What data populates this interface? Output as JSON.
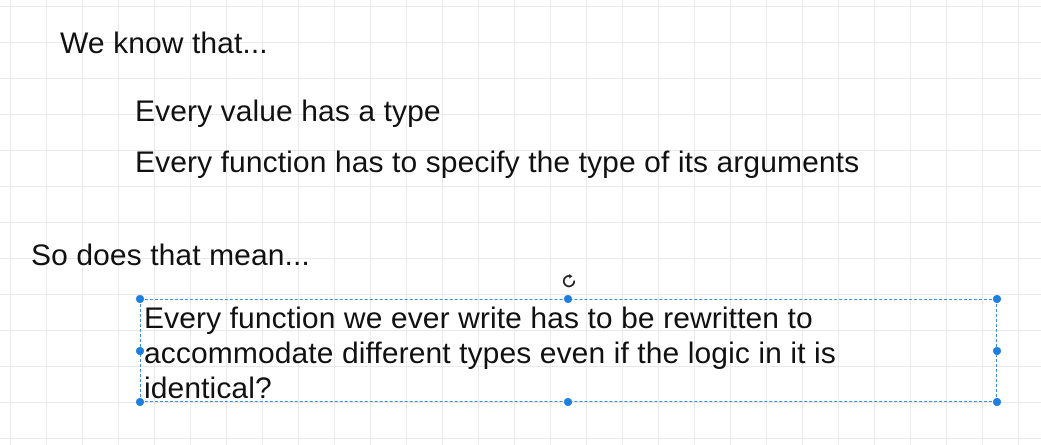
{
  "slide": {
    "heading_1": "We know that...",
    "bullets": [
      "Every value has a type",
      "Every function has to specify the type of its arguments"
    ],
    "heading_2": "So does that mean...",
    "selected_text_box": {
      "text": "Every function we ever write has to be rewritten to accommodate different types even if the logic in it is identical?"
    }
  },
  "colors": {
    "selection": "#3a8fd8",
    "handle": "#1f7fe0",
    "grid": "#e9e9e9",
    "text": "#111111"
  },
  "icons": {
    "rotate": "rotate-icon"
  }
}
